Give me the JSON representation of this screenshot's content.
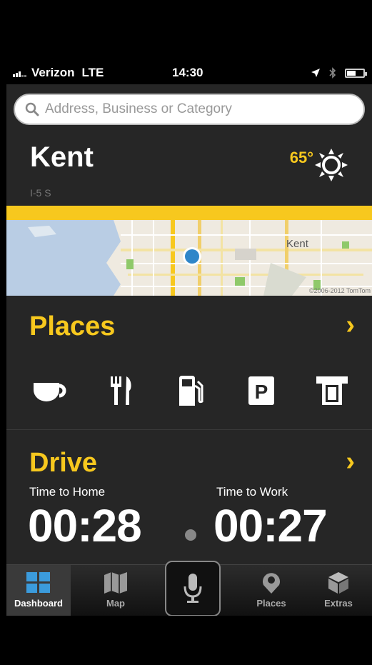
{
  "status": {
    "carrier": "Verizon",
    "network": "LTE",
    "time": "14:30"
  },
  "search": {
    "placeholder": "Address, Business or Category"
  },
  "location": {
    "city": "Kent",
    "road": "I-5 S",
    "temperature": "65°"
  },
  "map": {
    "city_label": "Kent",
    "copyright": "©2006-2012 TomTom"
  },
  "places": {
    "title": "Places",
    "chevron": "›",
    "categories": [
      "coffee-icon",
      "restaurant-icon",
      "gas-station-icon",
      "parking-icon",
      "atm-icon"
    ]
  },
  "drive": {
    "title": "Drive",
    "chevron": "›",
    "home_label": "Time to Home",
    "home_time": "00:28",
    "work_label": "Time to Work",
    "work_time": "00:27"
  },
  "tabbar": {
    "dashboard": "Dashboard",
    "map": "Map",
    "places": "Places",
    "extras": "Extras"
  },
  "colors": {
    "accent": "#f7c81e",
    "background": "#262626",
    "active_tab_icon": "#3b9bdc"
  }
}
